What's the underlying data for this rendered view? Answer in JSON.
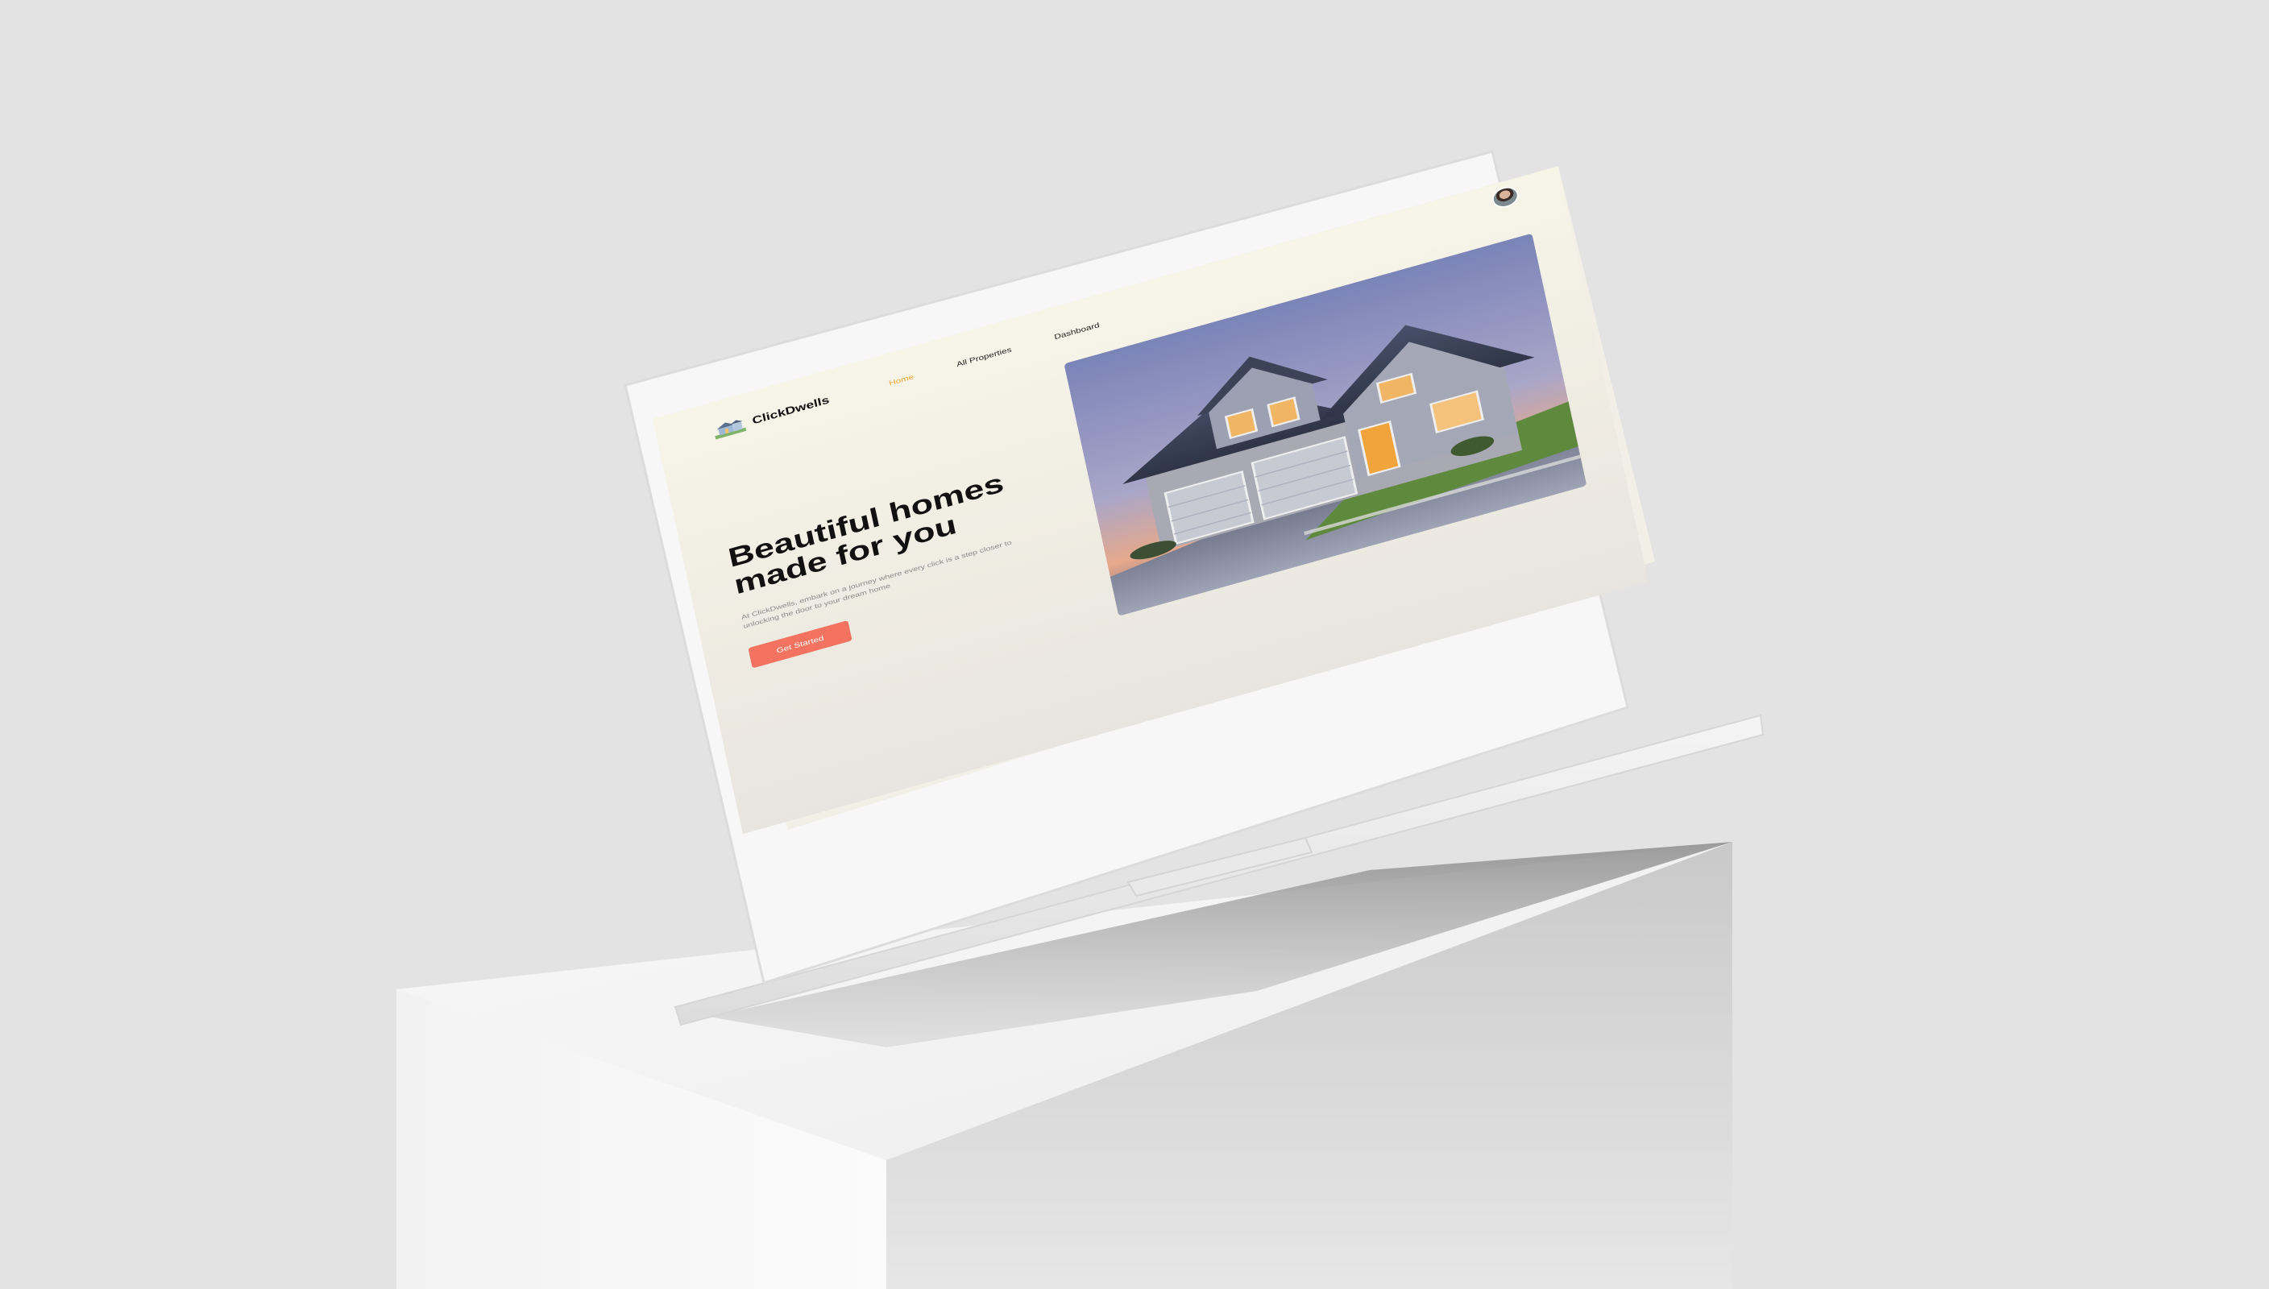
{
  "brand": {
    "name": "ClickDwells"
  },
  "nav": {
    "home": "Home",
    "all_properties": "All Properties",
    "dashboard": "Dashboard"
  },
  "hero": {
    "title": "Beautiful homes made for you",
    "description": "At ClickDwells, embark on a journey where every click is a step closer to unlocking the door to your dream home",
    "cta": "Get Started"
  },
  "colors": {
    "accent": "#f37260",
    "nav_active": "#f0a534",
    "background": "#e3e3e3"
  },
  "icons": {
    "logo": "house-logo-icon",
    "avatar": "user-avatar"
  }
}
